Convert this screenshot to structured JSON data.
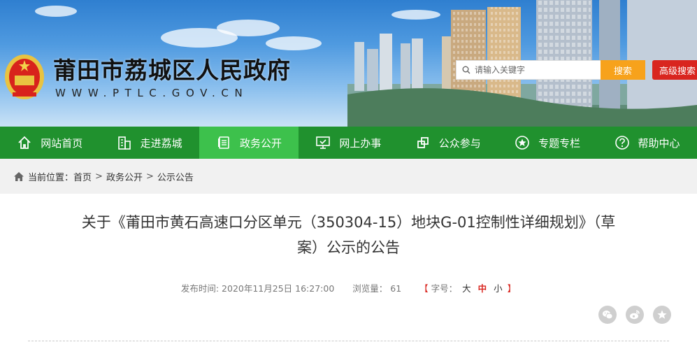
{
  "header": {
    "site_title": "莆田市荔城区人民政府",
    "site_url": "WWW.PTLC.GOV.CN",
    "search": {
      "placeholder": "请输入关键字",
      "button_label": "搜索",
      "advanced_label": "高级搜索"
    }
  },
  "nav": {
    "items": [
      {
        "label": "网站首页",
        "icon": "home-icon"
      },
      {
        "label": "走进荔城",
        "icon": "building-icon"
      },
      {
        "label": "政务公开",
        "icon": "document-icon",
        "active": true
      },
      {
        "label": "网上办事",
        "icon": "monitor-icon"
      },
      {
        "label": "公众参与",
        "icon": "link-icon"
      },
      {
        "label": "专题专栏",
        "icon": "star-icon"
      },
      {
        "label": "帮助中心",
        "icon": "help-icon"
      }
    ]
  },
  "breadcrumb": {
    "prefix": "当前位置：",
    "items": [
      "首页",
      "政务公开",
      "公示公告"
    ],
    "separator": ">"
  },
  "article": {
    "title_line1": "关于《莆田市黄石高速口分区单元（350304-15）地块G-01控制性详细规划》（草",
    "title_line2": "案）公示的公告",
    "publish_label": "发布时间:",
    "publish_time": "2020年11月25日 16:27:00",
    "views_label": "浏览量：",
    "views": "61",
    "font_open": "【",
    "font_label": "字号：",
    "font_large": "大",
    "font_medium": "中",
    "font_small": "小",
    "font_close": "】"
  },
  "share": [
    "wechat-icon",
    "weibo-icon",
    "favorite-icon"
  ],
  "colors": {
    "nav_bg": "#20912e",
    "nav_active": "#3dc14c",
    "search_button": "#f7a21b",
    "advanced_button": "#d9251f",
    "breadcrumb_bg": "#f1f1f1"
  }
}
